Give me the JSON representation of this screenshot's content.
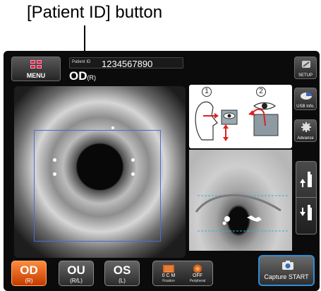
{
  "callout": {
    "text": "[Patient ID] button"
  },
  "header": {
    "menu_label": "MENU",
    "patient_id_tag": "Patient ID",
    "patient_id_value": "1234567890",
    "eye_side": "OD",
    "eye_side_sub": "(R)"
  },
  "sidebar": {
    "setup_label": "SETUP",
    "usb_label": "USB Info.",
    "advance_label": "Advance"
  },
  "guide": {
    "step1": "1",
    "step2": "2"
  },
  "bottom": {
    "od_label": "OD",
    "od_sub": "(R)",
    "ou_label": "OU",
    "ou_sub": "(R/L)",
    "os_label": "OS",
    "os_sub": "(L)",
    "fixation_value": "0 C M",
    "fixation_label": "Fixation",
    "peripheral_value": "OFF",
    "peripheral_label": "Peripheral",
    "capture_label": "Capture START"
  },
  "colors": {
    "active_eye": "#e55a0f",
    "scan_rect": "#4a6bd8",
    "capture_border": "#2e8dd4",
    "guide_line": "#3ab0c8"
  }
}
